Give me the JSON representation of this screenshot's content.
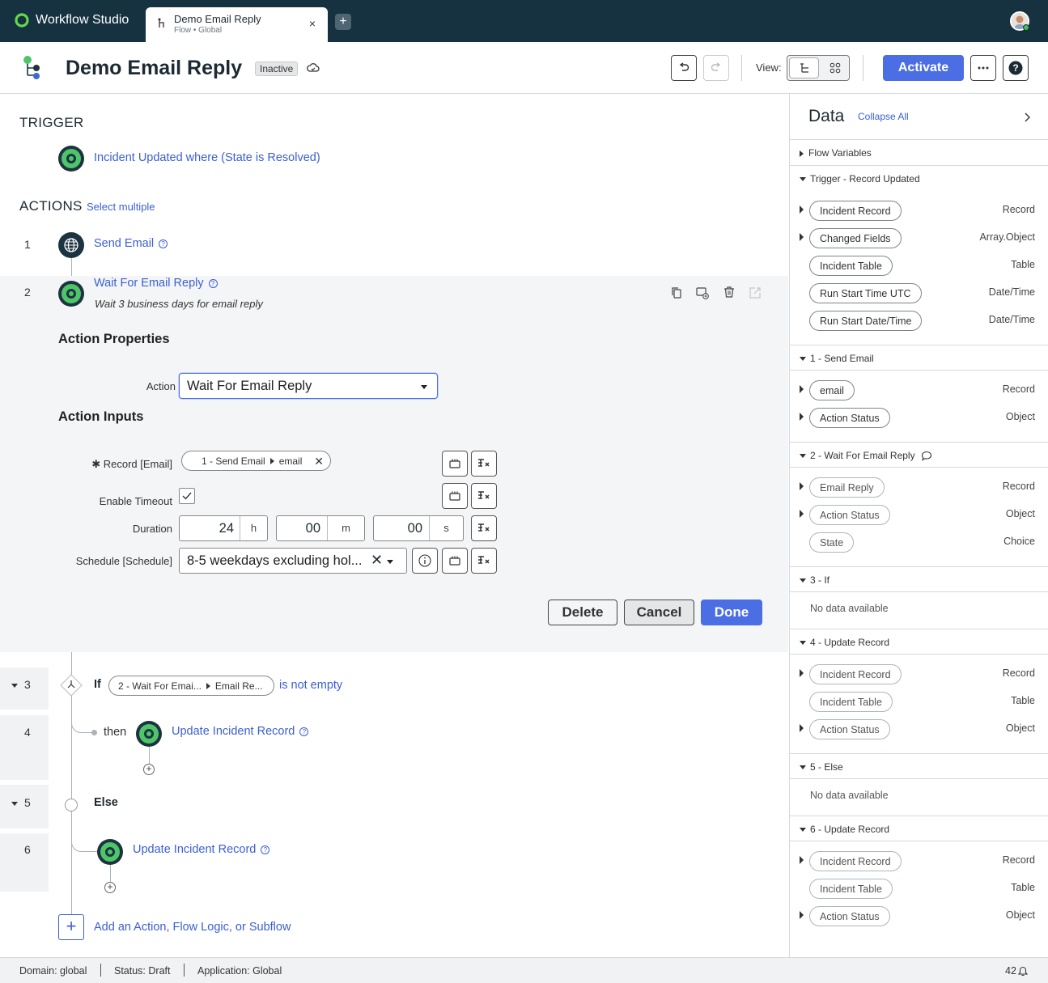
{
  "app": {
    "name": "Workflow Studio"
  },
  "tab": {
    "title": "Demo Email Reply",
    "subtitle": "Flow • Global",
    "close": "×",
    "new_tab": "+"
  },
  "header": {
    "title": "Demo Email Reply",
    "status": "Inactive",
    "view_label": "View:",
    "activate": "Activate"
  },
  "trigger": {
    "heading": "TRIGGER",
    "label": "Incident Updated where (State is Resolved)"
  },
  "actions": {
    "heading": "ACTIONS",
    "select_multiple": "Select multiple",
    "steps": [
      {
        "num": "1",
        "label": "Send Email"
      },
      {
        "num": "2",
        "label": "Wait For Email Reply",
        "description": "Wait 3 business days for email reply"
      },
      {
        "num": "3",
        "if_word": "If",
        "pill_a": "2 - Wait For Emai...",
        "pill_b": "Email Re...",
        "condition": "is not empty"
      },
      {
        "num": "4",
        "then_word": "then",
        "label": "Update Incident Record"
      },
      {
        "num": "5",
        "label": "Else"
      },
      {
        "num": "6",
        "label": "Update Incident Record"
      }
    ],
    "add_label": "Add an Action, Flow Logic, or Subflow"
  },
  "edit": {
    "properties_heading": "Action Properties",
    "action_label": "Action",
    "action_value": "Wait For Email Reply",
    "inputs_heading": "Action Inputs",
    "record_label": "Record [Email]",
    "record_pill_a": "1 - Send Email",
    "record_pill_b": "email",
    "timeout_label": "Enable Timeout",
    "duration_label": "Duration",
    "duration": {
      "h": "24",
      "h_unit": "h",
      "m": "00",
      "m_unit": "m",
      "s": "00",
      "s_unit": "s"
    },
    "schedule_label": "Schedule [Schedule]",
    "schedule_value": "8-5 weekdays excluding hol...",
    "delete": "Delete",
    "cancel": "Cancel",
    "done": "Done"
  },
  "data_panel": {
    "title": "Data",
    "collapse_all": "Collapse All",
    "sections": [
      {
        "title": "Flow Variables",
        "collapsed": true,
        "items": []
      },
      {
        "title": "Trigger - Record Updated",
        "items": [
          {
            "label": "Incident Record",
            "type": "Record",
            "expandable": true
          },
          {
            "label": "Changed Fields",
            "type": "Array.Object",
            "expandable": true
          },
          {
            "label": "Incident Table",
            "type": "Table",
            "expandable": false
          },
          {
            "label": "Run Start Time UTC",
            "type": "Date/Time",
            "expandable": false
          },
          {
            "label": "Run Start Date/Time",
            "type": "Date/Time",
            "expandable": false
          }
        ]
      },
      {
        "title": "1 - Send Email",
        "items": [
          {
            "label": "email",
            "type": "Record",
            "expandable": true
          },
          {
            "label": "Action Status",
            "type": "Object",
            "expandable": true
          }
        ]
      },
      {
        "title": "2 - Wait For Email Reply",
        "items": [
          {
            "label": "Email Reply",
            "type": "Record",
            "expandable": true
          },
          {
            "label": "Action Status",
            "type": "Object",
            "expandable": true
          },
          {
            "label": "State",
            "type": "Choice",
            "expandable": false
          }
        ]
      },
      {
        "title": "3 - If",
        "nodata": "No data available",
        "items": []
      },
      {
        "title": "4 - Update Record",
        "items": [
          {
            "label": "Incident Record",
            "type": "Record",
            "expandable": true
          },
          {
            "label": "Incident Table",
            "type": "Table",
            "expandable": false
          },
          {
            "label": "Action Status",
            "type": "Object",
            "expandable": true
          }
        ]
      },
      {
        "title": "5 - Else",
        "nodata": "No data available",
        "items": []
      },
      {
        "title": "6 - Update Record",
        "items": [
          {
            "label": "Incident Record",
            "type": "Record",
            "expandable": true
          },
          {
            "label": "Incident Table",
            "type": "Table",
            "expandable": false
          },
          {
            "label": "Action Status",
            "type": "Object",
            "expandable": true
          }
        ]
      }
    ]
  },
  "footer": {
    "domain": "Domain: global",
    "status": "Status: Draft",
    "application": "Application: Global",
    "count": "42"
  }
}
